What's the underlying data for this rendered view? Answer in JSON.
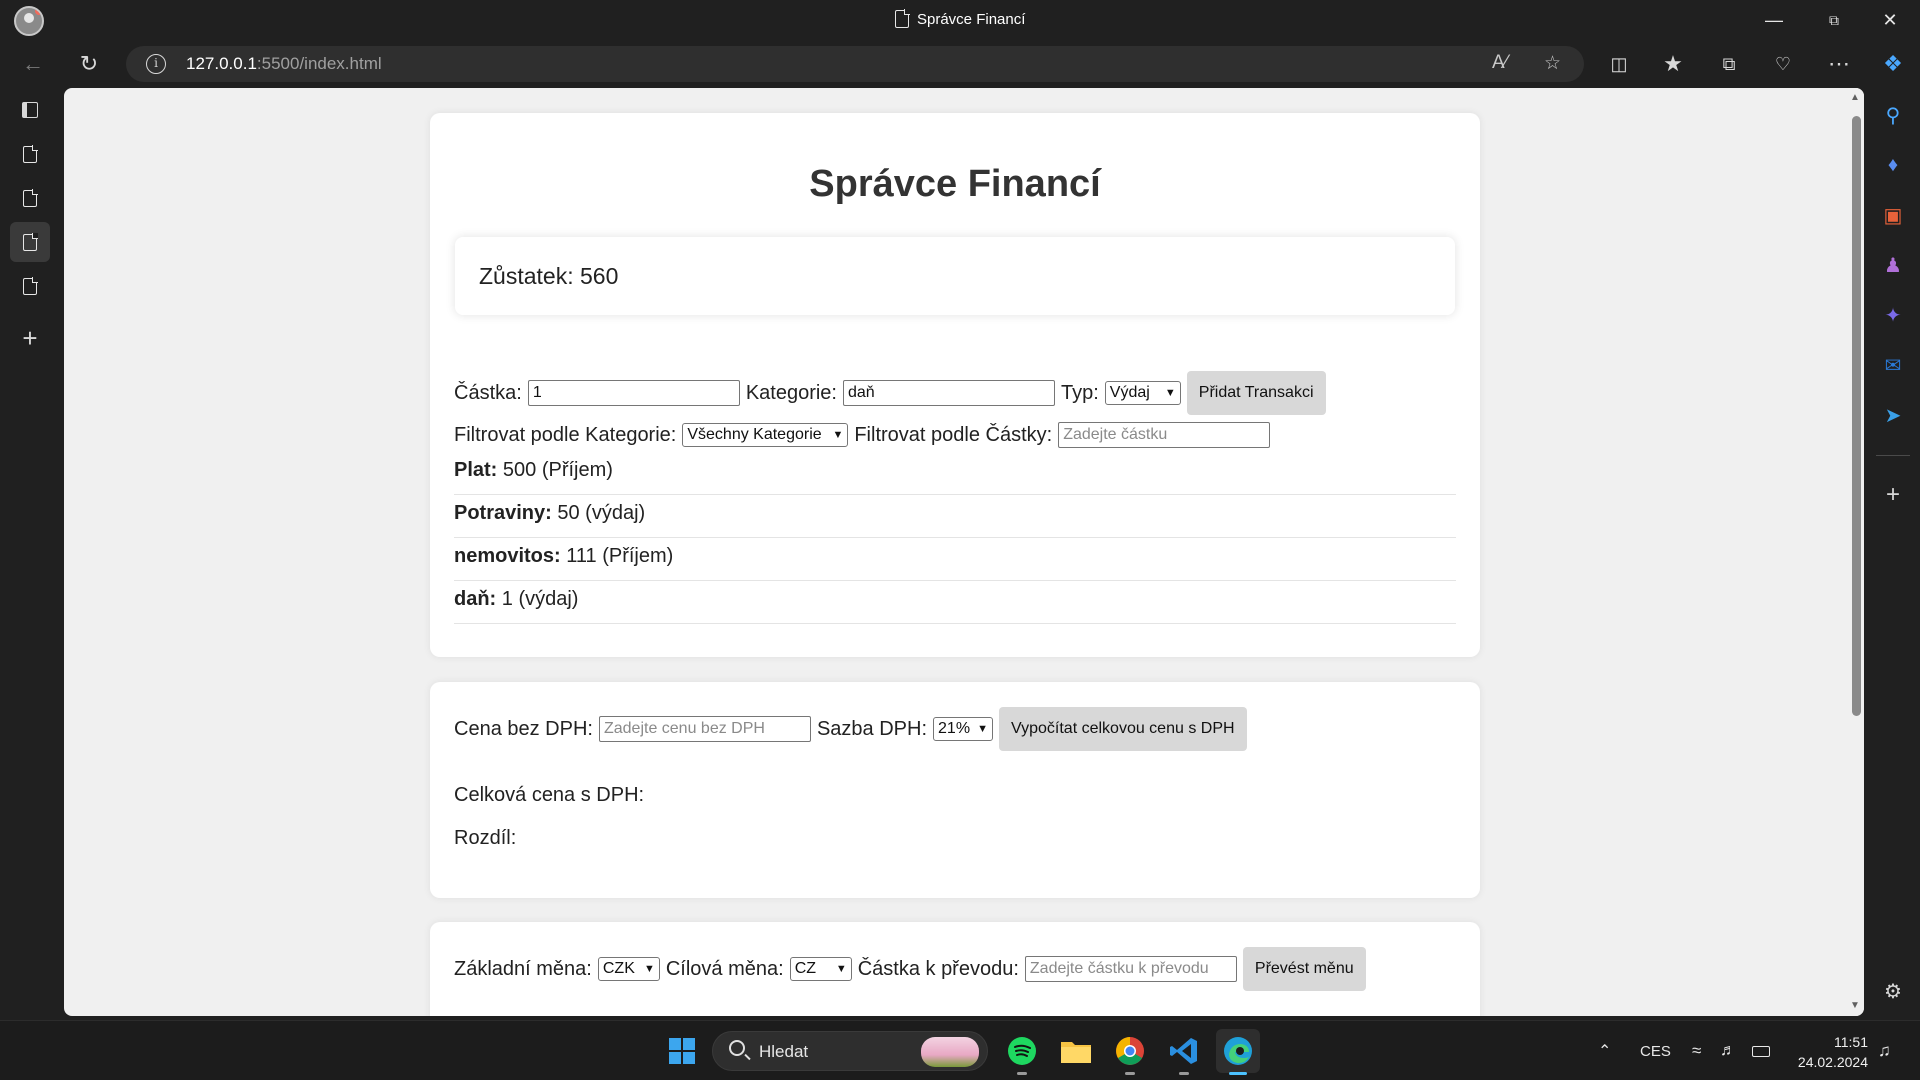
{
  "browser": {
    "tab_title": "Správce Financí",
    "url_host": "127.0.0.1",
    "url_rest": ":5500/index.html"
  },
  "page": {
    "title": "Správce Financí",
    "balance_text": "Zůstatek: 560",
    "add_form": {
      "amount_label": "Částka:",
      "amount_value": "1",
      "category_label": "Kategorie:",
      "category_value": "daň",
      "type_label": "Typ:",
      "type_selected": "Výdaj",
      "add_button": "Přidat Transakci"
    },
    "filter": {
      "category_label": "Filtrovat podle Kategorie:",
      "category_selected": "Všechny Kategorie",
      "amount_label": "Filtrovat podle Částky:",
      "amount_placeholder": "Zadejte částku"
    },
    "transactions": [
      {
        "name": "Plat:",
        "detail": " 500 (Příjem)"
      },
      {
        "name": "Potraviny:",
        "detail": " 50 (výdaj)"
      },
      {
        "name": "nemovitos:",
        "detail": " 111 (Příjem)"
      },
      {
        "name": "daň:",
        "detail": " 1 (výdaj)"
      }
    ],
    "vat": {
      "price_label": "Cena bez DPH:",
      "price_placeholder": "Zadejte cenu bez DPH",
      "rate_label": "Sazba DPH:",
      "rate_selected": "21%",
      "calc_button": "Vypočítat celkovou cenu s DPH",
      "total_label": "Celková cena s DPH:",
      "diff_label": "Rozdíl:"
    },
    "currency": {
      "base_label": "Základní měna:",
      "base_selected": "CZK",
      "target_label": "Cílová měna:",
      "target_selected": "CZ",
      "amount_label": "Částka k převodu:",
      "amount_placeholder": "Zadejte částku k převodu",
      "convert_button": "Převést měnu"
    }
  },
  "taskbar": {
    "search_label": "Hledat",
    "language": "CES",
    "time": "11:51",
    "date": "24.02.2024"
  }
}
